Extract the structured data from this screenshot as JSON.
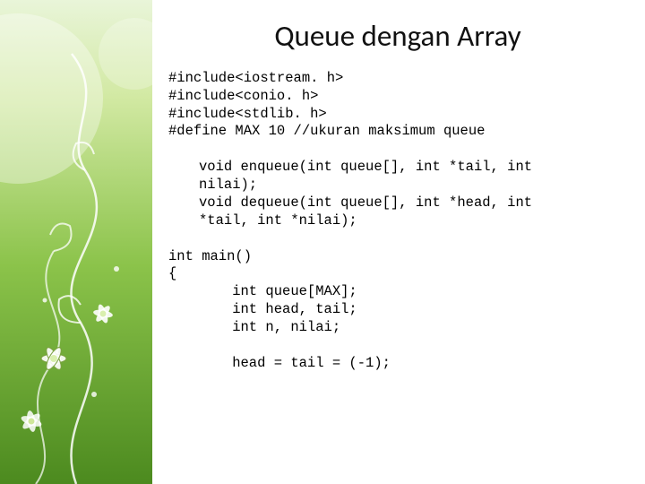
{
  "slide": {
    "title": "Queue dengan Array",
    "code": {
      "includes": "#include<iostream. h>\n#include<conio. h>\n#include<stdlib. h>\n#define MAX 10 //ukuran maksimum queue",
      "prototypes": "void enqueue(int queue[], int *tail, int\nnilai);\nvoid dequeue(int queue[], int *head, int\n*tail, int *nilai);",
      "main_sig": "int main()\n{",
      "main_body": "    int queue[MAX];\n    int head, tail;\n    int n, nilai;\n\n    head = tail = (-1);"
    }
  }
}
